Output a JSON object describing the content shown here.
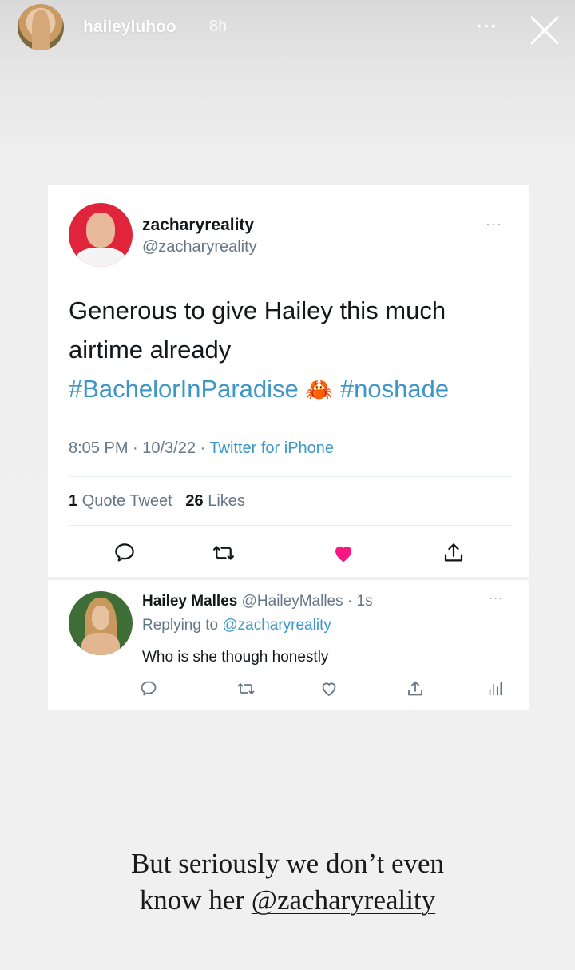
{
  "story": {
    "username": "haileyluhoo",
    "time": "8h",
    "more_label": "···",
    "caption_line1": "But seriously we don’t even",
    "caption_line2_prefix": "know her ",
    "caption_mention": "@zacharyreality"
  },
  "tweet": {
    "name": "zacharyreality",
    "handle": "@zacharyreality",
    "more_label": "···",
    "text_line1": "Generous to give Hailey this much",
    "text_line2": "airtime already",
    "hashtag1": "#BachelorInParadise",
    "emoji": "🦀",
    "hashtag2": "#noshade",
    "time": "8:05 PM · 10/3/22 · ",
    "source": "Twitter for iPhone",
    "quote_count": "1",
    "quote_label": "Quote Tweet",
    "like_count": "26",
    "like_label": "Likes",
    "icons": [
      "reply-icon",
      "retweet-icon",
      "like-icon",
      "share-icon"
    ],
    "like_color": "#f91880"
  },
  "reply": {
    "name": "Hailey Malles",
    "handle_time": "@HaileyMalles · 1s",
    "more_label": "···",
    "replying_prefix": "Replying to ",
    "replying_to": "@zacharyreality",
    "text": "Who is she though honestly",
    "icons": [
      "reply-icon",
      "retweet-icon",
      "like-icon",
      "share-icon",
      "analytics-icon"
    ]
  },
  "colors": {
    "link": "#3c96c8",
    "text": "#14171a",
    "muted": "#657786",
    "like": "#f91880"
  }
}
